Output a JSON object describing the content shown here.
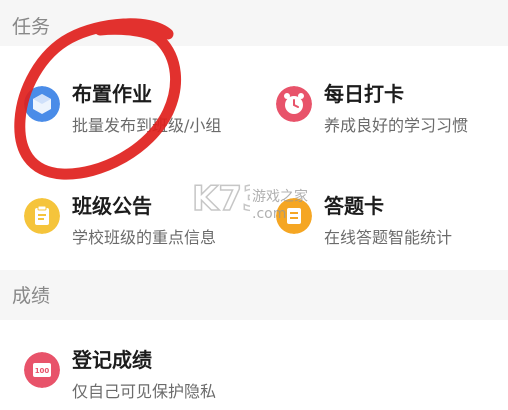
{
  "sections": {
    "task_title": "任务",
    "grade_title": "成绩"
  },
  "items": {
    "assign": {
      "label": "布置作业",
      "desc": "批量发布到班级/小组",
      "icon": "cube-icon",
      "color": "#4a8ce8"
    },
    "checkin": {
      "label": "每日打卡",
      "desc": "养成良好的学习习惯",
      "icon": "alarm-clock-icon",
      "color": "#e8536a"
    },
    "notice": {
      "label": "班级公告",
      "desc": "学校班级的重点信息",
      "icon": "notice-icon",
      "color": "#f5c43b"
    },
    "answer": {
      "label": "答题卡",
      "desc": "在线答题智能统计",
      "icon": "answer-sheet-icon",
      "color": "#f5a623"
    },
    "grade": {
      "label": "登记成绩",
      "desc": "仅自己可见保护隐私",
      "icon": "score-icon",
      "color": "#e8536a",
      "icon_text": "100"
    }
  },
  "watermark": {
    "logo": "K73",
    "text": "游戏之家",
    "sub": ".com"
  },
  "colors": {
    "annotation": "#e0201c"
  }
}
